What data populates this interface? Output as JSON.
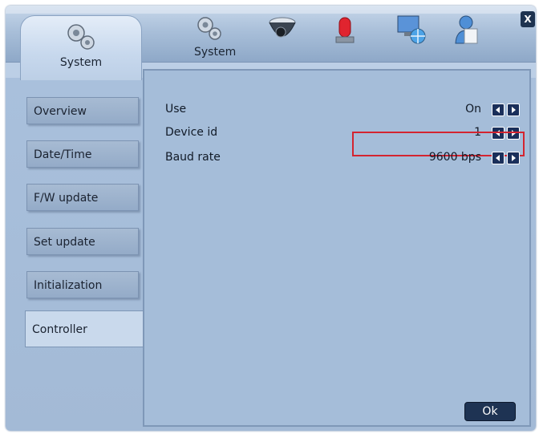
{
  "window": {
    "close_label": "X"
  },
  "header": {
    "active_tab_label": "System",
    "tab_icons": [
      "gears-icon",
      "camera-icon",
      "alarm-light-icon",
      "network-icon",
      "user-icon"
    ],
    "tab_caption": "System"
  },
  "sidebar": {
    "items": [
      {
        "label": "Overview",
        "active": false
      },
      {
        "label": "Date/Time",
        "active": false
      },
      {
        "label": "F/W update",
        "active": false
      },
      {
        "label": "Set update",
        "active": false
      },
      {
        "label": "Initialization",
        "active": false
      },
      {
        "label": "Controller",
        "active": true
      }
    ]
  },
  "main": {
    "rows": [
      {
        "label": "Use",
        "value": "On"
      },
      {
        "label": "Device id",
        "value": "1"
      },
      {
        "label": "Baud rate",
        "value": "9600 bps"
      }
    ],
    "ok_label": "Ok"
  },
  "colors": {
    "accent": "#1a2f5a",
    "highlight": "#d42430",
    "panel": "#a5bdd9"
  }
}
